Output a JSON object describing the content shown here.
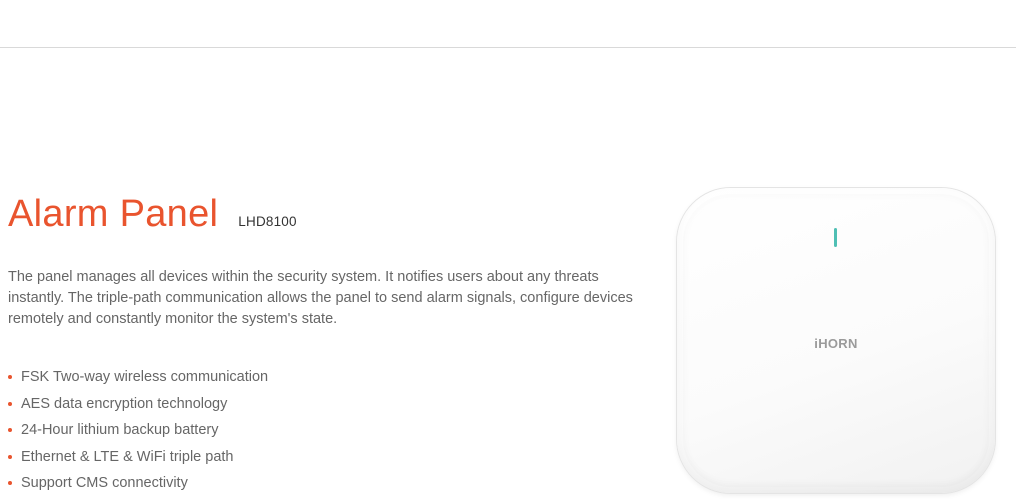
{
  "product": {
    "title": "Alarm Panel",
    "model": "LHD8100",
    "description": "The panel manages all devices within the security system. It notifies users about any threats instantly. The triple-path communication allows the panel to send alarm signals, configure devices remotely and constantly monitor the system's state.",
    "features": [
      "FSK Two-way wireless communication",
      "AES data encryption technology",
      "24-Hour lithium backup battery",
      "Ethernet & LTE & WiFi triple path",
      "Support CMS connectivity"
    ]
  },
  "device_image": {
    "brand": "iHORN",
    "led_color": "#4fbfb4"
  },
  "colors": {
    "accent": "#e9542e",
    "body_text": "#666666"
  }
}
